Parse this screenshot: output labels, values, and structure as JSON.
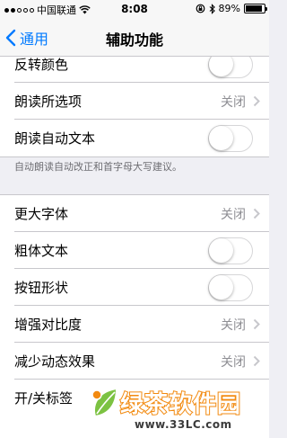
{
  "status_bar": {
    "carrier": "中国联通",
    "time": "8:08",
    "battery": "89%",
    "battery_level": 0.89,
    "signal_bars_filled": 2,
    "signal_bars_total": 5
  },
  "nav": {
    "back_label": "通用",
    "title": "辅助功能"
  },
  "group1": {
    "rows": [
      {
        "label": "反转颜色",
        "control": "toggle",
        "on": false
      },
      {
        "label": "朗读所选项",
        "value": "关闭",
        "control": "disclosure"
      },
      {
        "label": "朗读自动文本",
        "control": "toggle",
        "on": false
      }
    ],
    "footer": "自动朗读自动改正和首字母大写建议。"
  },
  "group2": {
    "rows": [
      {
        "label": "更大字体",
        "value": "关闭",
        "control": "disclosure"
      },
      {
        "label": "粗体文本",
        "control": "toggle",
        "on": false
      },
      {
        "label": "按钮形状",
        "control": "toggle",
        "on": false
      },
      {
        "label": "增强对比度",
        "value": "关闭",
        "control": "disclosure"
      },
      {
        "label": "减少动态效果",
        "value": "关闭",
        "control": "disclosure"
      },
      {
        "label": "开/关标签",
        "control": "toggle",
        "on": false
      }
    ]
  },
  "watermark": {
    "brand": "绿茶软件园",
    "url": "www.33LC.com"
  },
  "colors": {
    "accent": "#007aff",
    "background": "#efeff4",
    "separator": "#c8c7cc",
    "secondary_text": "#8e8e93"
  }
}
